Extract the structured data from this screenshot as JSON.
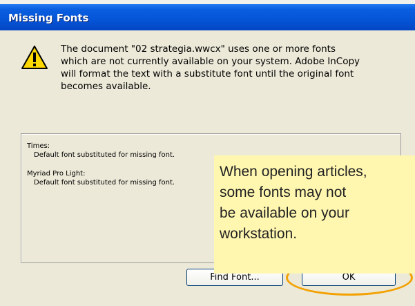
{
  "window": {
    "title": "Missing Fonts"
  },
  "icons": {
    "warning": "warning-triangle-icon",
    "scroll_down": "chevron-down-icon"
  },
  "message": {
    "lines": [
      "The document \"02 strategia.wwcx\" uses one or more fonts",
      "which are not currently available on your system. Adobe InCopy",
      "will format the text with a substitute font until the original font",
      "becomes available."
    ]
  },
  "missing_fonts": [
    {
      "font": "Times:",
      "description": "Default font substituted for missing font."
    },
    {
      "font": "Myriad Pro Light:",
      "description": "Default font substituted for missing font."
    }
  ],
  "buttons": {
    "find_font": "Find Font...",
    "ok": "OK"
  },
  "callout": {
    "lines": [
      "When opening articles,",
      "some fonts may not",
      "be available on your",
      "workstation."
    ]
  },
  "colors": {
    "title_bar": "#0553d5",
    "dialog_bg": "#ece9d8",
    "callout_bg": "#fff7b0",
    "highlight": "#f2a100"
  }
}
